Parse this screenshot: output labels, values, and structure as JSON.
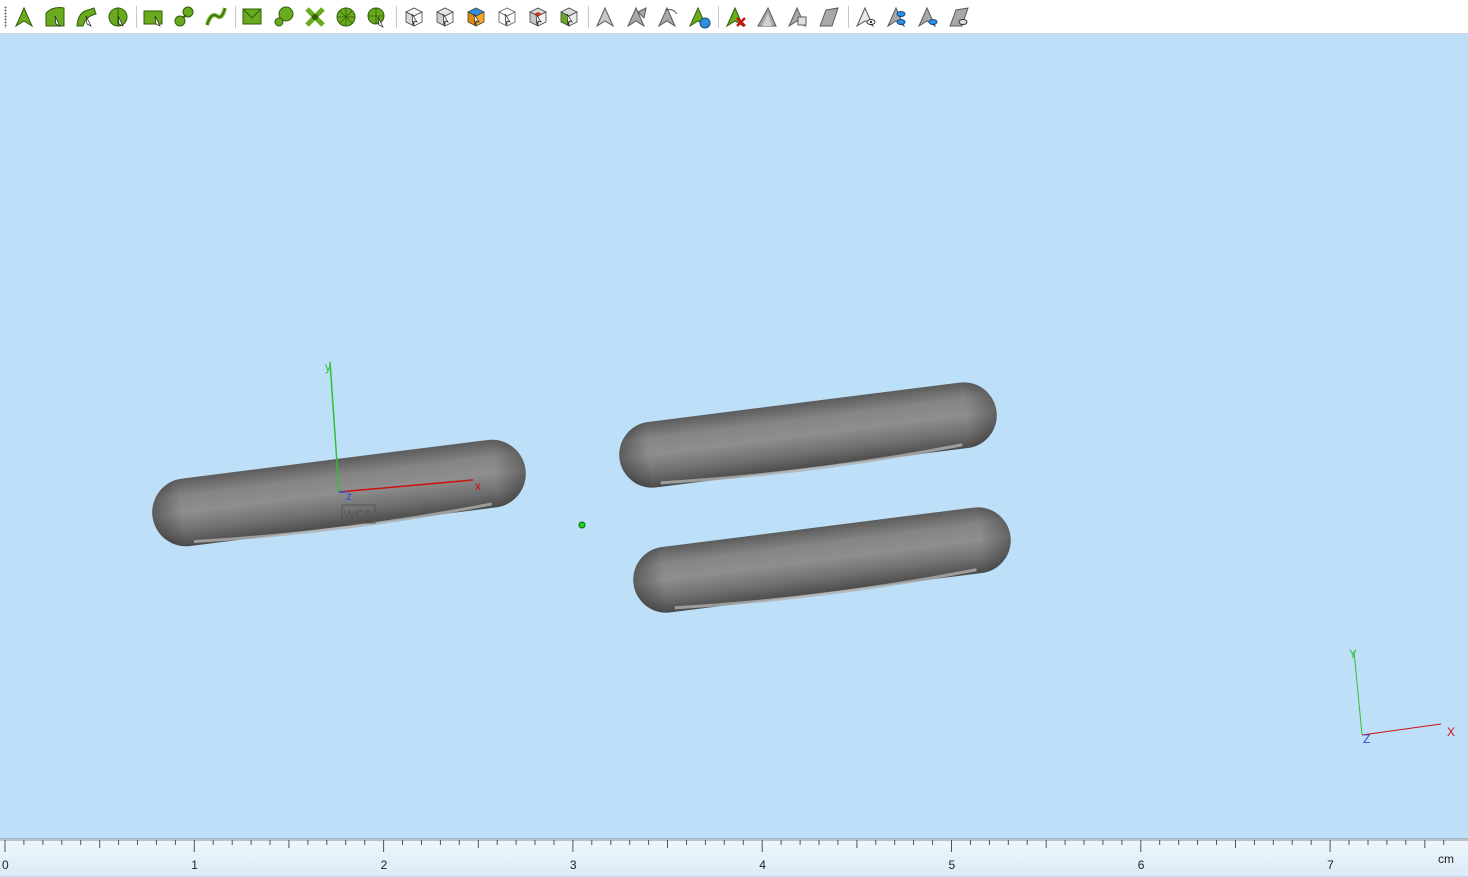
{
  "toolbar": {
    "buttons": [
      {
        "id": "pick-point-arrow",
        "icon": "pick-point-icon"
      },
      {
        "id": "pick-edge-arrow",
        "icon": "pick-edge-icon"
      },
      {
        "id": "pick-edge-curve",
        "icon": "pick-edge-curve-icon"
      },
      {
        "id": "pick-circle-center",
        "icon": "pick-circle-center-icon"
      },
      {
        "id": "pick-face",
        "icon": "pick-face-icon"
      },
      {
        "id": "pick-face-circle",
        "icon": "pick-face-circle-icon"
      },
      {
        "id": "pick-face-curve",
        "icon": "pick-face-curve-icon"
      },
      {
        "id": "pick-face-wedge",
        "icon": "pick-face-wedge-icon"
      },
      {
        "id": "pick-face-disc",
        "icon": "pick-face-disc-icon"
      },
      {
        "id": "pick-cross",
        "icon": "pick-cross-icon"
      },
      {
        "id": "pick-wheel",
        "icon": "pick-wheel-icon"
      },
      {
        "id": "pick-wheel-arrow",
        "icon": "pick-wheel-arrow-icon"
      },
      {
        "id": "select-solid",
        "icon": "select-solid-icon"
      },
      {
        "id": "select-box",
        "icon": "select-box-icon"
      },
      {
        "id": "select-box-orange",
        "icon": "select-box-orange-icon"
      },
      {
        "id": "select-wire-box",
        "icon": "select-wire-box-icon"
      },
      {
        "id": "select-box-red",
        "icon": "select-box-red-icon"
      },
      {
        "id": "select-box-green",
        "icon": "select-box-green-icon"
      },
      {
        "id": "pick-gray-1",
        "icon": "pick-gray-icon"
      },
      {
        "id": "pick-gray-2",
        "icon": "pick-gray-multi-icon"
      },
      {
        "id": "pick-gray-3",
        "icon": "pick-gray-curve-icon"
      },
      {
        "id": "pick-green-globe",
        "icon": "pick-globe-icon"
      },
      {
        "id": "clear-picks",
        "icon": "clear-picks-icon"
      },
      {
        "id": "pick-gray-4",
        "icon": "pick-gray-wedge-icon"
      },
      {
        "id": "pick-gray-5",
        "icon": "pick-gray-copy-icon"
      },
      {
        "id": "pick-gray-6",
        "icon": "pick-gray-face-icon"
      },
      {
        "id": "pick-eye-1",
        "icon": "pick-eye-icon"
      },
      {
        "id": "pick-eye-2",
        "icon": "pick-eye-multi-icon"
      },
      {
        "id": "pick-eye-3",
        "icon": "pick-eye-curve-icon"
      },
      {
        "id": "pick-eye-4",
        "icon": "pick-eye-face-icon"
      }
    ]
  },
  "scene": {
    "wcs_label": "WCS",
    "wcs_axis_x": "x",
    "wcs_axis_y": "y",
    "wcs_axis_z": "z",
    "tripod_x": "X",
    "tripod_y": "Y",
    "tripod_z": "Z",
    "object_count": 3
  },
  "ruler": {
    "labels": [
      "0",
      "1",
      "2",
      "3",
      "4",
      "5",
      "6",
      "7"
    ],
    "unit": "cm"
  },
  "colors": {
    "viewport_bg": "#bddff7",
    "x_axis": "#d01010",
    "y_axis": "#30c030",
    "z_axis": "#3050d0",
    "torus_light": "#8c8c8c",
    "torus_dark": "#3a3a3a",
    "center_point": "#22d022"
  }
}
